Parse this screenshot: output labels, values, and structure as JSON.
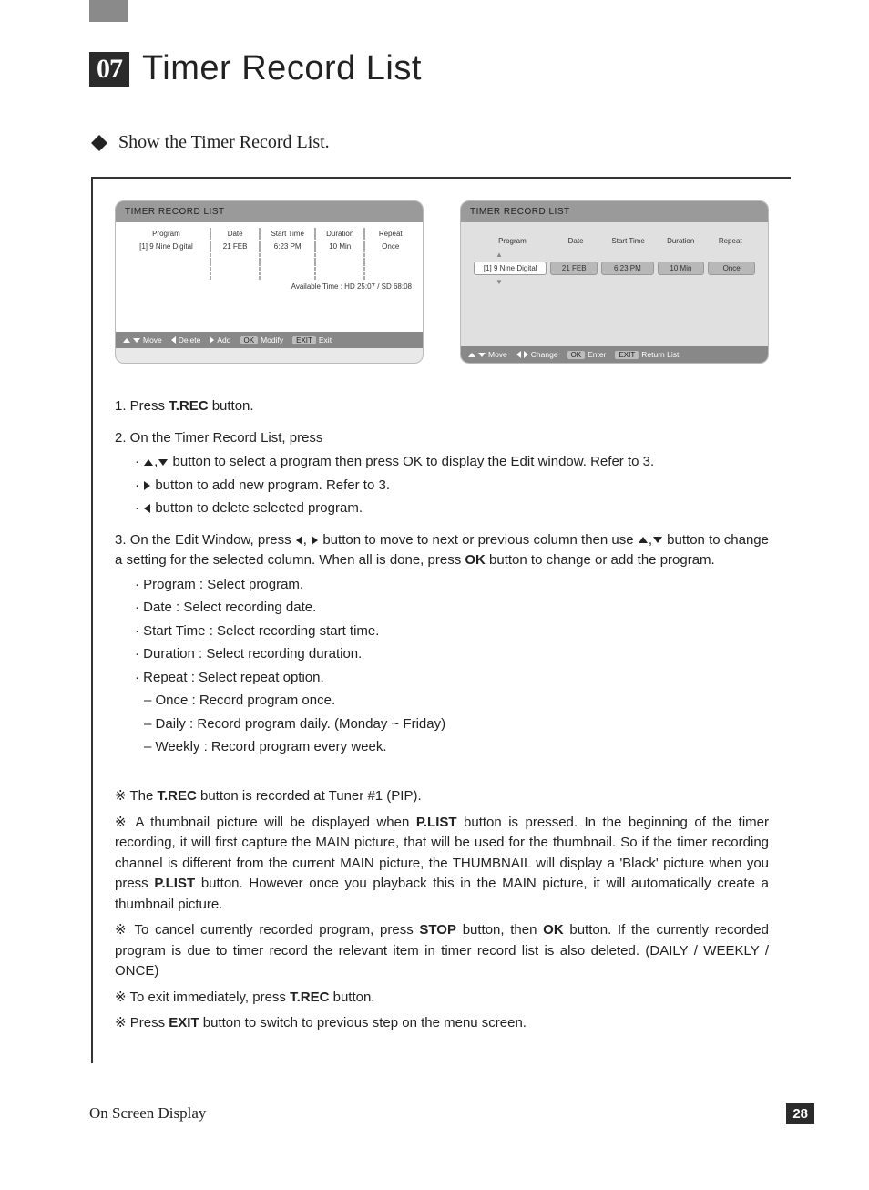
{
  "chapter": "07",
  "title": "Timer Record List",
  "subtitle": "Show the Timer Record List.",
  "screens": {
    "left": {
      "title": "TIMER RECORD LIST",
      "columns": [
        "Program",
        "Date",
        "Start Time",
        "Duration",
        "Repeat"
      ],
      "row": [
        "[1] 9 Nine Digital",
        "21 FEB",
        "6:23 PM",
        "10 Min",
        "Once"
      ],
      "available": "Available Time : HD 25:07 / SD 68:08",
      "footer": {
        "move": "Move",
        "delete": "Delete",
        "add": "Add",
        "ok": "OK",
        "modify": "Modify",
        "exitk": "EXIT",
        "exit": "Exit"
      }
    },
    "right": {
      "title": "TIMER RECORD LIST",
      "columns": [
        "Program",
        "Date",
        "Start Time",
        "Duration",
        "Repeat"
      ],
      "row": [
        "[1] 9 Nine Digital",
        "21 FEB",
        "6:23 PM",
        "10 Min",
        "Once"
      ],
      "footer": {
        "move": "Move",
        "change": "Change",
        "ok": "OK",
        "enter": "Enter",
        "exitk": "EXIT",
        "return": "Return List"
      }
    }
  },
  "steps": {
    "s1": {
      "prefix": "1. Press ",
      "bold": "T.REC",
      "suffix": " button."
    },
    "s2": "2. On the Timer Record List, press",
    "s2a": " button to select a program then press OK to display the Edit window. Refer to 3.",
    "s2b": " button to add new program. Refer to 3.",
    "s2c": " button to delete selected program.",
    "s3a": "3. On the Edit Window, press ",
    "s3b": " button to move to next or previous column then use ",
    "s3c": " button to change a setting for the selected column. When all is done, press ",
    "s3ok": "OK",
    "s3d": " button to change or add the program."
  },
  "fields": {
    "program": "Program : Select program.",
    "date": "Date : Select recording date.",
    "start": "Start Time : Select recording start time.",
    "duration": "Duration : Select recording duration.",
    "repeat": "Repeat : Select repeat option.",
    "once": "Once : Record program once.",
    "daily": "Daily : Record program daily. (Monday ~ Friday)",
    "weekly": "Weekly : Record program every week."
  },
  "notes": {
    "n1": {
      "a": "The ",
      "b": "T.REC",
      "c": " button is recorded at  Tuner #1 (PIP)."
    },
    "n2": {
      "a": "A thumbnail picture will be displayed when ",
      "b": "P.LIST",
      "c": " button is pressed. In the beginning of the timer recording, it will first capture the MAIN picture, that will be used for the thumbnail. So if the timer recording channel is different from the current MAIN picture, the THUMBNAIL will display a 'Black' picture when you press ",
      "d": "P.LIST",
      "e": " button. However once you playback this in the MAIN picture, it will automatically create a thumbnail picture."
    },
    "n3": {
      "a": "To cancel currently recorded program, press ",
      "b": "STOP",
      "c": " button, then ",
      "d": "OK",
      "e": " button. If the currently recorded program is due to timer record the relevant item in timer record list is also deleted. (DAILY / WEEKLY / ONCE)"
    },
    "n4": {
      "a": "To exit immediately, press ",
      "b": "T.REC",
      "c": " button."
    },
    "n5": {
      "a": "Press ",
      "b": "EXIT",
      "c": " button to switch to previous step on the menu screen."
    }
  },
  "footer": {
    "section": "On Screen Display",
    "page": "28"
  }
}
